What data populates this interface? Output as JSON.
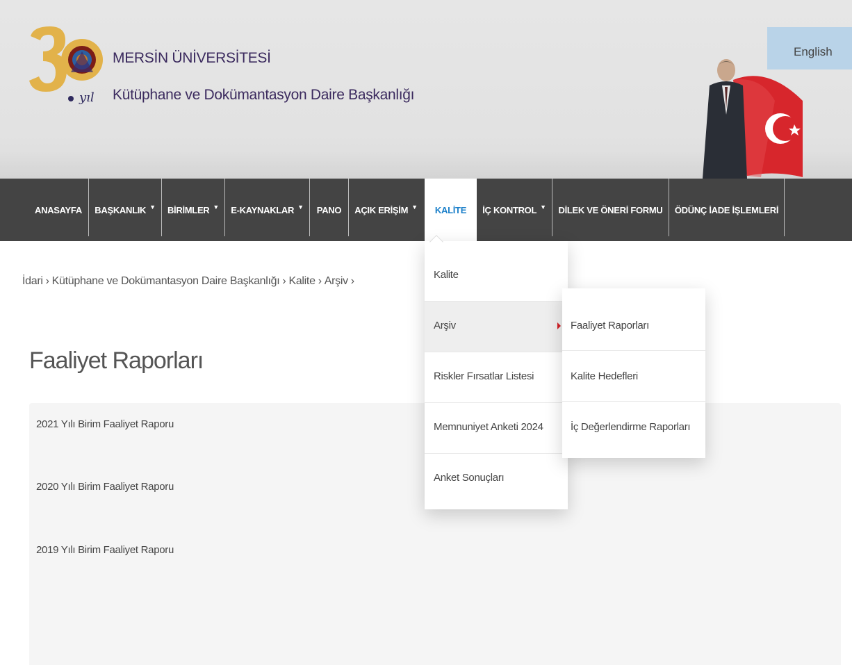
{
  "header": {
    "title": "MERSİN ÜNİVERSİTESİ",
    "subtitle": "Kütüphane ve Dokümantasyon Daire Başkanlığı",
    "language_button": "English",
    "logo_icon": "university-30-year-logo"
  },
  "nav": {
    "items": [
      {
        "label": "ANASAYFA",
        "has_dropdown": false
      },
      {
        "label": "BAŞKANLIK",
        "has_dropdown": true
      },
      {
        "label": "BİRİMLER",
        "has_dropdown": true
      },
      {
        "label": "E-KAYNAKLAR",
        "has_dropdown": true
      },
      {
        "label": "PANO",
        "has_dropdown": false
      },
      {
        "label": "AÇIK ERİŞİM",
        "has_dropdown": true
      },
      {
        "label": "KALİTE",
        "has_dropdown": false,
        "active": true
      },
      {
        "label": "İÇ KONTROL",
        "has_dropdown": true
      },
      {
        "label": "DİLEK VE ÖNERİ FORMU",
        "has_dropdown": false
      },
      {
        "label": "ÖDÜNÇ İADE İŞLEMLERİ",
        "has_dropdown": false
      }
    ],
    "caret_glyph": "▼",
    "active_color": "#1a7fc9",
    "bg_color": "#444444"
  },
  "breadcrumb": {
    "items": [
      "İdari",
      "Kütüphane ve Dokümantasyon Daire Başkanlığı",
      "Kalite",
      "Arşiv"
    ],
    "separator": "›"
  },
  "main": {
    "heading": "Faaliyet Raporları",
    "reports": [
      "2021 Yılı Birim Faaliyet Raporu",
      "2020 Yılı Birim Faaliyet Raporu",
      "2019 Yılı Birim Faaliyet Raporu"
    ]
  },
  "dropdown": {
    "items": [
      "Kalite",
      "Arşiv",
      "Riskler Fırsatlar Listesi",
      "Memnuniyet Anketi 2024",
      "Anket Sonuçları"
    ],
    "hovered": "Arşiv"
  },
  "submenu": {
    "items": [
      "Faaliyet Raporları",
      "Kalite Hedefleri",
      "İç Değerlendirme Raporları"
    ],
    "arrow_color": "#d32027"
  }
}
